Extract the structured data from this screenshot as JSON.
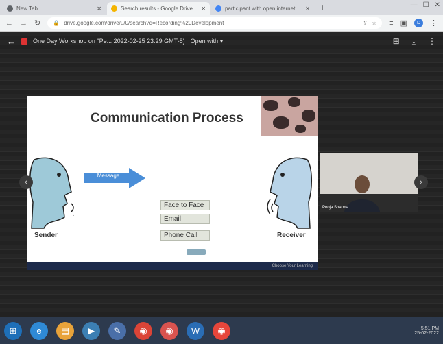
{
  "browser": {
    "tabs": [
      {
        "label": "New Tab",
        "icon_color": "#5f6368",
        "active": false
      },
      {
        "label": "Search results - Google Drive",
        "icon_color": "#f4b400",
        "active": true
      },
      {
        "label": "participant with open internet",
        "icon_color": "#4285f4",
        "active": false
      }
    ],
    "url": "drive.google.com/drive/u/0/search?q=Recording%20Development",
    "avatar_letter": "D"
  },
  "viewer": {
    "file_title": "One Day Workshop on \"Pe...  2022-02-25 23:29 GMT-8)",
    "open_with": "Open with"
  },
  "slide": {
    "title": "Communication Process",
    "message_label": "Message",
    "options": [
      "Face to Face",
      "Email",
      "Phone Call"
    ],
    "sender_label": "Sender",
    "receiver_label": "Receiver",
    "footer": "Choose Your Learning"
  },
  "video": {
    "participant_name": "Pooja Sharma"
  },
  "taskbar": {
    "time": "5:51 PM",
    "date": "25-02-2022"
  },
  "colors": {
    "arrow": "#4a8ed8",
    "head": "#9ec9d8",
    "taskbar": "#2d3a4e"
  }
}
